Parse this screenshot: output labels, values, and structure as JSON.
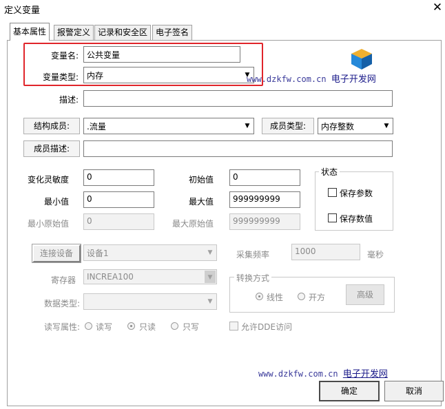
{
  "window": {
    "title": "定义变量",
    "close_glyph": "✕"
  },
  "tabs": [
    {
      "label": "基本属性",
      "active": true
    },
    {
      "label": "报警定义",
      "active": false
    },
    {
      "label": "记录和安全区",
      "active": false
    },
    {
      "label": "电子签名",
      "active": false
    }
  ],
  "basic": {
    "var_name_label": "变量名:",
    "var_name_value": "公共变量",
    "var_type_label": "变量类型:",
    "var_type_value": "内存",
    "desc_label": "描述:",
    "desc_value": "",
    "struct_member_label": "结构成员:",
    "struct_member_value": ".流量",
    "member_type_label": "成员类型:",
    "member_type_value": "内存整数",
    "member_desc_label": "成员描述:",
    "member_desc_value": ""
  },
  "numeric": {
    "sensitivity_label": "变化灵敏度",
    "sensitivity_value": "0",
    "init_label": "初始值",
    "init_value": "0",
    "min_label": "最小值",
    "min_value": "0",
    "max_label": "最大值",
    "max_value": "999999999",
    "min_raw_label": "最小原始值",
    "min_raw_value": "0",
    "max_raw_label": "最大原始值",
    "max_raw_value": "999999999"
  },
  "status": {
    "legend": "状态",
    "save_params_label": "保存参数",
    "save_params_checked": false,
    "save_values_label": "保存数值",
    "save_values_checked": false
  },
  "io": {
    "connect_button": "连接设备",
    "device_value": "设备1",
    "sample_rate_label": "采集频率",
    "sample_rate_value": "1000",
    "sample_rate_unit": "毫秒",
    "register_label": "寄存器",
    "register_value": "INCREA100",
    "data_type_label": "数据类型:",
    "data_type_value": "",
    "rw_label": "读写属性:",
    "rw_options": [
      {
        "label": "读写",
        "selected": false
      },
      {
        "label": "只读",
        "selected": true
      },
      {
        "label": "只写",
        "selected": false
      }
    ],
    "dde_label": "允许DDE访问",
    "dde_checked": false
  },
  "conversion": {
    "legend": "转换方式",
    "options": [
      {
        "label": "线性",
        "selected": true
      },
      {
        "label": "开方",
        "selected": false
      }
    ],
    "advanced_button": "高级"
  },
  "watermark": {
    "url": "www.dzkfw.com.cn",
    "site_name": "电子开发网"
  },
  "footer": {
    "ok_button": "确定",
    "cancel_button": "取消"
  },
  "colors": {
    "highlight_border": "#e0242a",
    "watermark_text": "#3a3a9a"
  }
}
